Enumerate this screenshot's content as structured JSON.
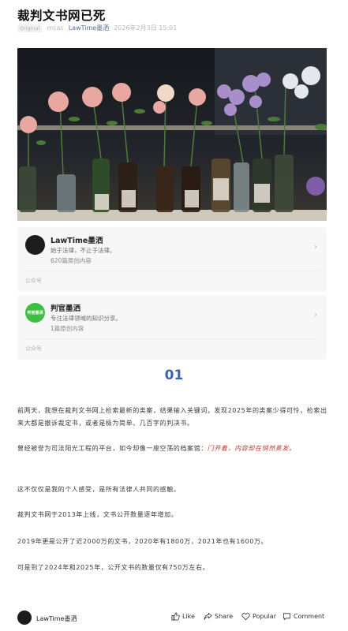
{
  "article": {
    "title": "裁判文书网已死",
    "original_tag": "Original",
    "author": "mcas",
    "account": "LawTime墨洒",
    "datetime": "2026年2月3日 15:01"
  },
  "cards": [
    {
      "name": "LawTime墨洒",
      "desc": "始于法律，不止于法律。",
      "count": "620篇原创内容",
      "type": "公众号"
    },
    {
      "name": "判官墨洒",
      "avatar_text": "判官墨洒",
      "desc": "专注法律领域的知识分享。",
      "count": "1篇原创内容",
      "type": "公众号"
    }
  ],
  "section_number": "01",
  "paragraphs": {
    "p1": "前两天，我想在裁判文书网上检索最新的类案，结果输入关键词，发现2025年的类案少得可怜，检索出来大都是撤诉裁定书，或者是极为简单、几百字的判决书。",
    "p2_text": "曾经被誉为司法阳光工程的平台，如今却像一座空荡的档案馆：",
    "p2_highlight": "门开着，内容却在悄然蒸发。",
    "p3": "这不仅仅是我的个人感受，是所有法律人共同的感触。",
    "p4": "裁判文书网于2013年上线，文书公开数量逐年增加。",
    "p5": "2019年更是公开了近2000万的文书，2020年有1800万，2021年也有1600万。",
    "p6": "可是到了2024年和2025年，公开文书的数量仅有750万左右。"
  },
  "bottom_bar": {
    "account": "LawTime墨洒",
    "like": "Like",
    "share": "Share",
    "popular": "Popular",
    "comment": "Comment"
  },
  "colors": {
    "accent_blue": "#3a63b0",
    "link_blue": "#576b95",
    "highlight_red": "#c7322a",
    "avatar_green": "#3dbf42"
  },
  "icons": {
    "chevron": "chevron-right-icon",
    "like": "thumbs-up-icon",
    "share": "share-arrow-icon",
    "popular": "heart-icon",
    "comment": "comment-bubble-icon"
  }
}
